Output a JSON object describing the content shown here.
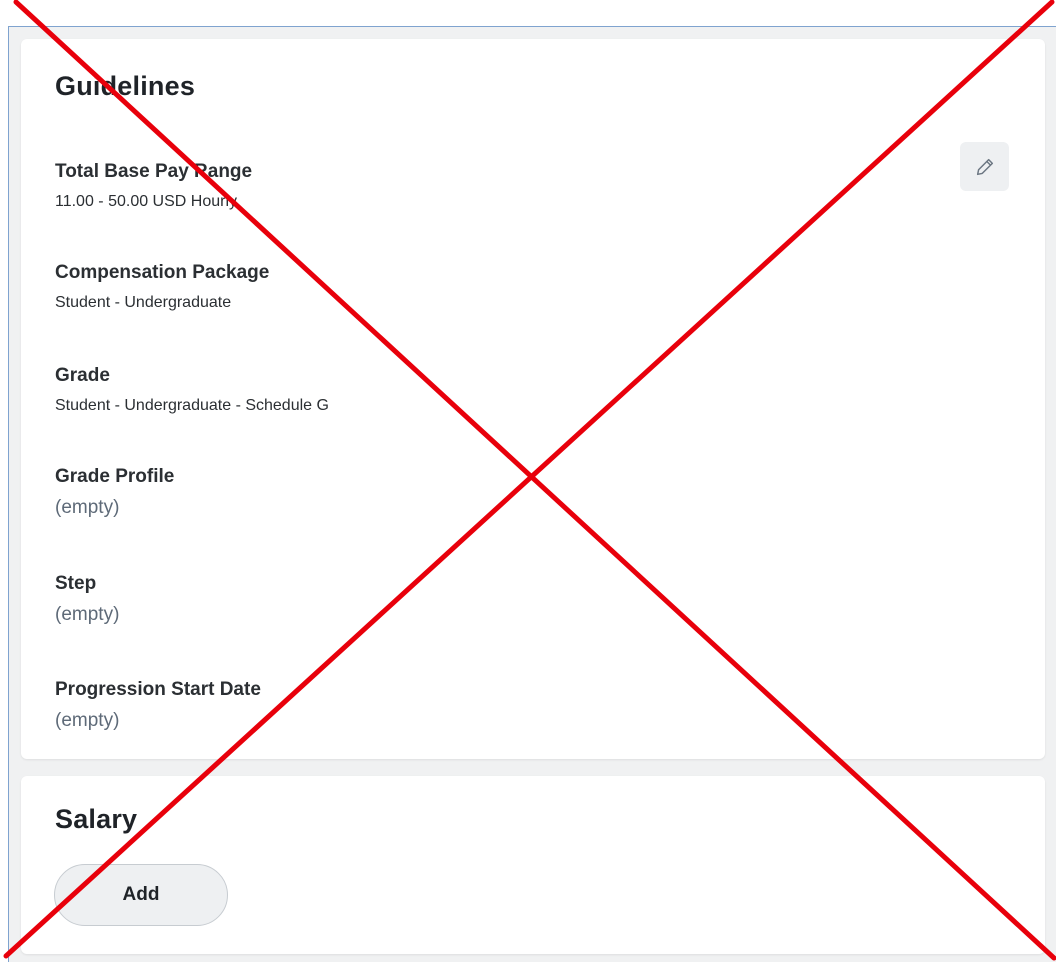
{
  "guidelines": {
    "title": "Guidelines",
    "edit_icon": "pencil-icon",
    "fields": [
      {
        "label": "Total Base Pay Range",
        "value": "11.00 - 50.00 USD Hourly"
      },
      {
        "label": "Compensation Package",
        "value": "Student - Undergraduate"
      },
      {
        "label": "Grade",
        "value": "Student - Undergraduate - Schedule G"
      },
      {
        "label": "Grade Profile",
        "value": "(empty)"
      },
      {
        "label": "Step",
        "value": "(empty)"
      },
      {
        "label": "Progression Start Date",
        "value": "(empty)"
      }
    ]
  },
  "salary": {
    "title": "Salary",
    "add_label": "Add"
  },
  "overlay": {
    "symbol": "red-x-cross",
    "color": "#e8000b"
  },
  "colors": {
    "page_bg": "#f0f1f2",
    "card_bg": "#ffffff",
    "label_text": "#2b2f33",
    "empty_text": "#5e6a78",
    "button_bg": "#eef0f2"
  }
}
